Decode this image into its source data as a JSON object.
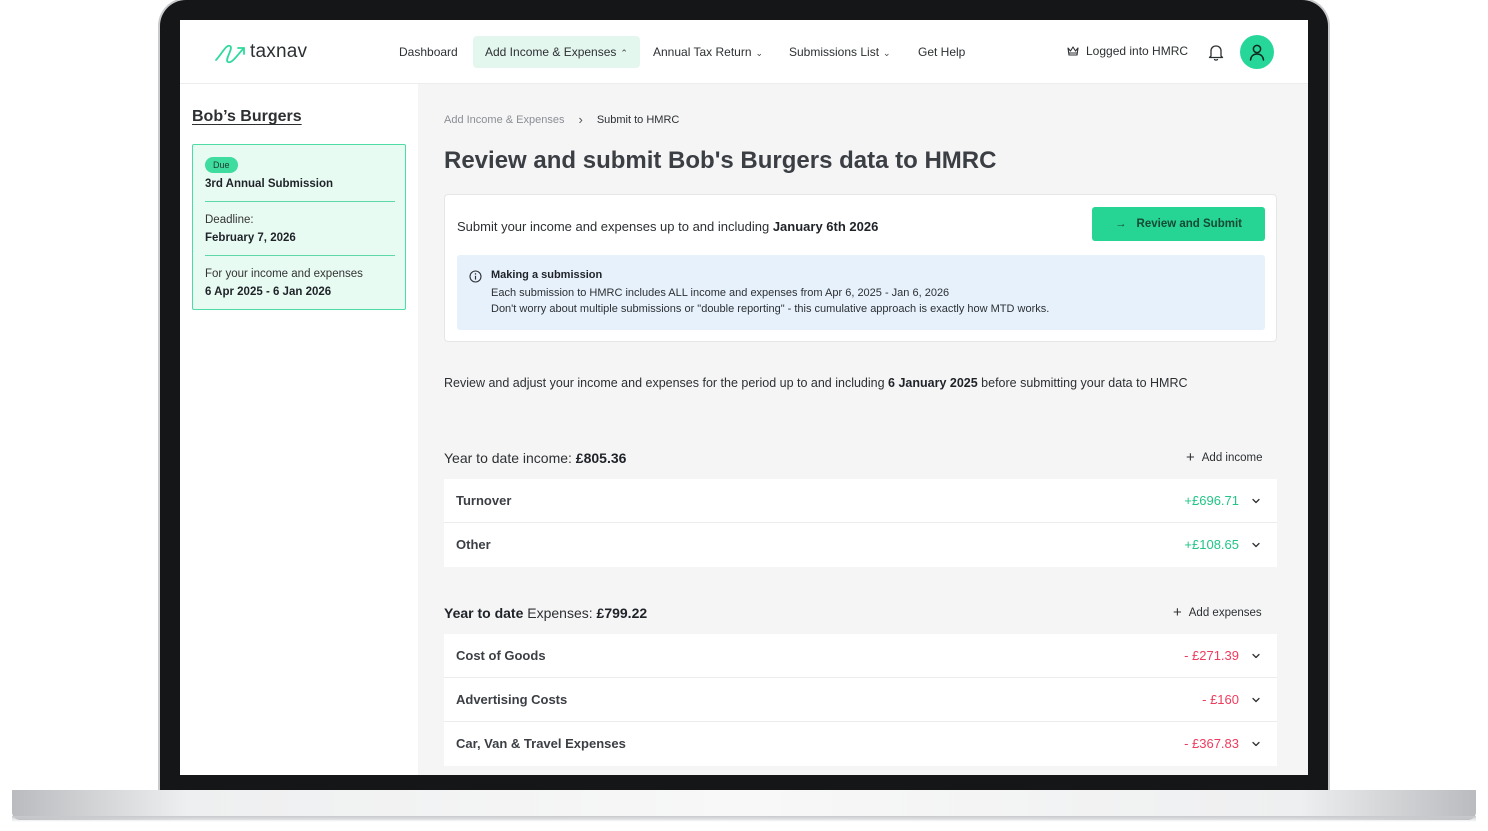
{
  "colors": {
    "brand_green": "#26d493",
    "positive": "#22c586",
    "negative": "#ef3b5d",
    "info_bg": "#e6f1fc",
    "due_card_bg": "#e8fbf3"
  },
  "nav": {
    "logo_text": "taxnav",
    "items": [
      {
        "label": "Dashboard"
      },
      {
        "label": "Add Income & Expenses",
        "active": true,
        "icon": "chevron-up-icon"
      },
      {
        "label": "Annual Tax Return",
        "icon": "chevron-down-icon"
      },
      {
        "label": "Submissions List",
        "icon": "chevron-down-icon"
      },
      {
        "label": "Get Help"
      }
    ],
    "hmrc_status": "Logged into HMRC",
    "icons": [
      "crown-icon",
      "bell-icon",
      "user-icon"
    ]
  },
  "sidebar": {
    "business_name": "Bob’s Burgers",
    "card": {
      "badge": "Due",
      "title": "3rd Annual Submission",
      "deadline_label": "Deadline:",
      "deadline_value": "February 7,  2026",
      "period_label": "For your income and expenses",
      "period_value": "6 Apr 2025 - 6 Jan 2026"
    }
  },
  "breadcrumb": {
    "items": [
      "Add  Income & Expenses",
      "Submit to HMRC"
    ]
  },
  "page": {
    "title": "Review and submit Bob's Burgers data to HMRC"
  },
  "submit": {
    "text_prefix": "Submit your income and expenses up to and including ",
    "date": "January 6th 2026",
    "button_label": "Review and Submit"
  },
  "info": {
    "title": "Making a submission",
    "line1": "Each submission to HMRC  includes ALL income and expenses from Apr 6, 2025 - Jan 6, 2026",
    "line2": "Don't worry about multiple submissions or \"double reporting\" - this cumulative approach is exactly how MTD works."
  },
  "review": {
    "prefix": "Review and adjust your income and expenses for the period up to and including ",
    "date": "6 January  2025",
    "suffix": "  before submitting your data to HMRC"
  },
  "income": {
    "heading_label": "Year to date income:  ",
    "total": "£805.36",
    "add_label": "Add income",
    "rows": [
      {
        "label": "Turnover",
        "amount": "+£696.71"
      },
      {
        "label": "Other",
        "amount": "+£108.65"
      }
    ]
  },
  "expenses": {
    "heading_label": "Year to date ",
    "heading_label2": "Expenses:",
    "total": " £799.22",
    "add_label": "Add expenses",
    "rows": [
      {
        "label": "Cost of Goods",
        "amount": "- £271.39"
      },
      {
        "label": "Advertising Costs",
        "amount": "- £160"
      },
      {
        "label": "Car, Van & Travel Expenses",
        "amount": "- £367.83"
      }
    ]
  }
}
